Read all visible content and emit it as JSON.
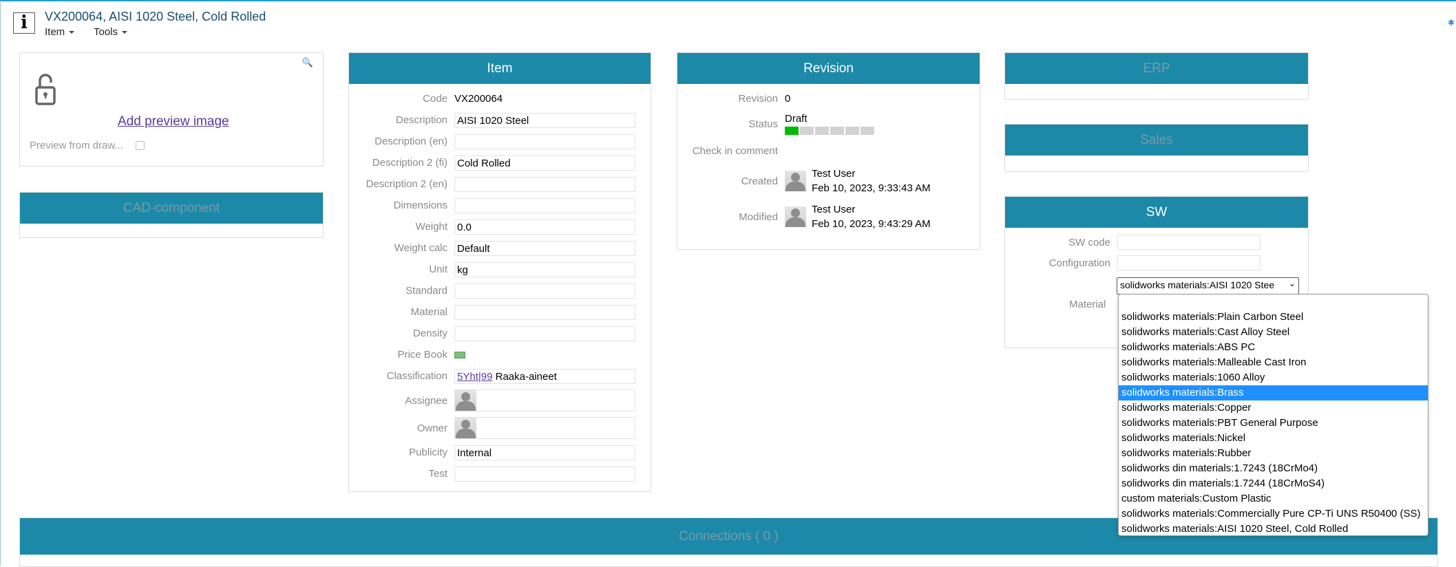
{
  "header": {
    "title": "VX200064, AISI 1020 Steel, Cold Rolled",
    "menus": [
      "Item",
      "Tools"
    ]
  },
  "preview": {
    "link": "Add preview image",
    "checkbox_label": "Preview from draw..."
  },
  "cad": {
    "title": "CAD-component"
  },
  "item": {
    "title": "Item",
    "rows": [
      {
        "label": "Code",
        "value": "VX200064"
      },
      {
        "label": "Description",
        "value": "AISI 1020 Steel"
      },
      {
        "label": "Description (en)",
        "value": ""
      },
      {
        "label": "Description 2 (fi)",
        "value": "Cold Rolled"
      },
      {
        "label": "Description 2 (en)",
        "value": ""
      },
      {
        "label": "Dimensions",
        "value": ""
      },
      {
        "label": "Weight",
        "value": "0.0"
      },
      {
        "label": "Weight calc",
        "value": "Default"
      },
      {
        "label": "Unit",
        "value": "kg"
      },
      {
        "label": "Standard",
        "value": ""
      },
      {
        "label": "Material",
        "value": ""
      },
      {
        "label": "Density",
        "value": ""
      },
      {
        "label": "Price Book",
        "value": ""
      },
      {
        "label": "Classification",
        "link": "5Yht|99",
        "value": "Raaka-aineet"
      },
      {
        "label": "Assignee",
        "value": ""
      },
      {
        "label": "Owner",
        "value": ""
      },
      {
        "label": "Publicity",
        "value": "Internal"
      },
      {
        "label": "Test",
        "value": ""
      }
    ]
  },
  "revision": {
    "title": "Revision",
    "revision_label": "Revision",
    "revision": "0",
    "status_label": "Status",
    "status": "Draft",
    "status_progress": "1/6",
    "checkin_label": "Check in comment",
    "created_label": "Created",
    "created_user": "Test User",
    "created_time": "Feb 10, 2023, 9:33:43 AM",
    "modified_label": "Modified",
    "modified_user": "Test User",
    "modified_time": "Feb 10, 2023, 9:43:29 AM"
  },
  "erp": {
    "title": "ERP"
  },
  "sales": {
    "title": "Sales"
  },
  "sw": {
    "title": "SW",
    "code_label": "SW code",
    "config_label": "Configuration",
    "material_label": "Material",
    "material_selected": "solidworks materials:AISI 1020 Stee",
    "options": [
      "solidworks materials:Plain Carbon Steel",
      "solidworks materials:Cast Alloy Steel",
      "solidworks materials:ABS PC",
      "solidworks materials:Malleable Cast Iron",
      "solidworks materials:1060 Alloy",
      "solidworks materials:Brass",
      "solidworks materials:Copper",
      "solidworks materials:PBT General Purpose",
      "solidworks materials:Nickel",
      "solidworks materials:Rubber",
      "solidworks din materials:1.7243 (18CrMo4)",
      "solidworks din materials:1.7244 (18CrMoS4)",
      "custom materials:Custom Plastic",
      "solidworks materials:Commercially Pure CP-Ti UNS R50400 (SS)",
      "solidworks materials:AISI 1020 Steel, Cold Rolled"
    ],
    "highlighted": "solidworks materials:Brass"
  },
  "connections": {
    "title": "Connections ( 0 )"
  }
}
